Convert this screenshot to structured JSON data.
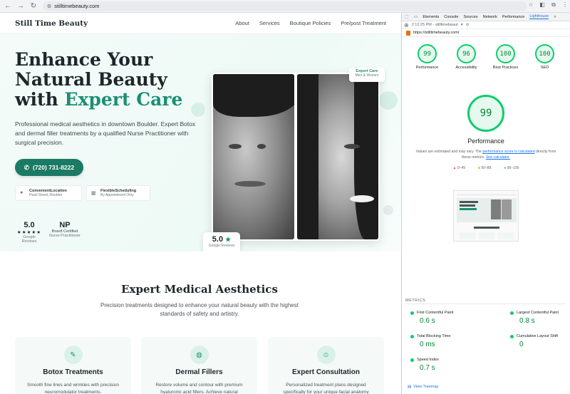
{
  "browser": {
    "url": "stilltimebeauty.com",
    "nav_icons": [
      "back-icon",
      "forward-icon",
      "reload-icon"
    ],
    "toolbar_icons": [
      "star-icon",
      "extensions-icon",
      "puzzle-icon",
      "menu-icon"
    ]
  },
  "site": {
    "brand": "Still Time Beauty",
    "nav": [
      "About",
      "Services",
      "Boutique Policies",
      "Pre/post Treatment"
    ],
    "hero": {
      "headline_line1": "Enhance Your",
      "headline_line2": "Natural Beauty",
      "headline_line3_plain": "with ",
      "headline_line3_accent": "Expert Care",
      "lead": "Professional medical aesthetics in downtown Boulder. Expert Botox and dermal filler treatments by a qualified Nurse Practitioner with surgical precision.",
      "phone": "(720) 731-8222",
      "info_cards": [
        {
          "title": "ConvenientLocation",
          "detail": "Pearl Street, Boulder"
        },
        {
          "title": "FlexibleScheduling",
          "detail": "By Appointment Only"
        }
      ],
      "stats": [
        {
          "big": "5.0",
          "stars": "★★★★★",
          "small": "Google Reviews"
        },
        {
          "big": "NP",
          "line2": "Board Certified",
          "small": "Nurse Practitioner"
        }
      ],
      "badge_care_title": "Expert Care",
      "badge_care_sub": "Men & Women",
      "badge_rating_value": "5.0",
      "badge_rating_label": "Google Reviews"
    },
    "section2": {
      "title": "Expert Medical Aesthetics",
      "subtitle": "Precision treatments designed to enhance your natural beauty with the highest standards of safety and artistry.",
      "services": [
        {
          "title": "Botox Treatments",
          "desc": "Smooth fine lines and wrinkles with precision neuromodulator treatments.",
          "icon": "syringe-icon"
        },
        {
          "title": "Dermal Fillers",
          "desc": "Restore volume and contour with premium hyaluronic acid fillers. Achieve natural",
          "icon": "droplet-icon"
        },
        {
          "title": "Expert Consultation",
          "desc": "Personalized treatment plans designed specifically for your unique facial anatomy",
          "icon": "user-check-icon"
        }
      ]
    }
  },
  "devtools": {
    "tabs": [
      "Elements",
      "Console",
      "Sources",
      "Network",
      "Performance",
      "Lighthouse"
    ],
    "active_tab": "Lighthouse",
    "report_time": "2:12:25 PM - stilltimebeaut",
    "report_url": "https://stilltimebeauty.com/",
    "scores": [
      {
        "value": "99",
        "label": "Performance"
      },
      {
        "value": "96",
        "label": "Accessibility"
      },
      {
        "value": "100",
        "label": "Best Practices"
      },
      {
        "value": "100",
        "label": "SEO"
      }
    ],
    "main_score": "99",
    "main_label": "Performance",
    "note_prefix": "Values are estimated and may vary. The ",
    "note_link1": "performance score is calculated",
    "note_mid": " directly from these metrics. ",
    "note_link2": "See calculator.",
    "legend": [
      "0–49",
      "50–89",
      "90–100"
    ],
    "metrics_header": "METRICS",
    "metrics": [
      {
        "label": "First Contentful Paint",
        "value": "0.6 s"
      },
      {
        "label": "Largest Contentful Paint",
        "value": "0.8 s"
      },
      {
        "label": "Total Blocking Time",
        "value": "0 ms"
      },
      {
        "label": "Cumulative Layout Shift",
        "value": "0"
      },
      {
        "label": "Speed Index",
        "value": "0.7 s"
      }
    ],
    "treemap_label": "View Treemap",
    "colors": {
      "pass": "#0cce6b",
      "average": "#ffa400",
      "fail": "#ff4e42",
      "accent": "#1a8f73"
    }
  }
}
